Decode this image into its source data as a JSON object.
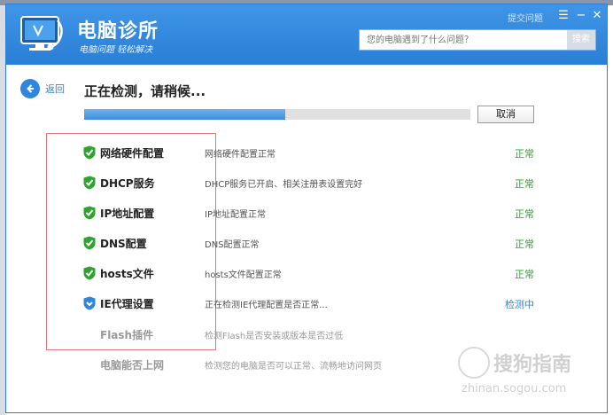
{
  "window": {
    "app_title": "电脑诊所",
    "app_subtitle": "电脑问题 轻松解决",
    "feedback": "提交问题"
  },
  "search": {
    "placeholder": "您的电脑遇到了什么问题？",
    "button_label": "搜索"
  },
  "nav": {
    "back_label": "返回"
  },
  "scan": {
    "status_title": "正在检测，请稍候...",
    "progress": 0.52,
    "cancel_label": "取消"
  },
  "checks": [
    {
      "name": "网络硬件配置",
      "desc": "网络硬件配置正常",
      "state": "正常",
      "status": "ok"
    },
    {
      "name": "DHCP服务",
      "desc": "DHCP服务已开启、相关注册表设置完好",
      "state": "正常",
      "status": "ok"
    },
    {
      "name": "IP地址配置",
      "desc": "IP地址配置正常",
      "state": "正常",
      "status": "ok"
    },
    {
      "name": "DNS配置",
      "desc": "DNS配置正常",
      "state": "正常",
      "status": "ok"
    },
    {
      "name": "hosts文件",
      "desc": "hosts文件配置正常",
      "state": "正常",
      "status": "ok"
    },
    {
      "name": "IE代理设置",
      "desc": "正在检测IE代理配置是否正常...",
      "state": "检测中",
      "status": "checking"
    },
    {
      "name": "Flash插件",
      "desc": "检测Flash是否安装或版本是否过低",
      "state": "",
      "status": "pending"
    },
    {
      "name": "电脑能否上网",
      "desc": "检测您的电脑是否可以正常、流畅地访问网页",
      "state": "",
      "status": "pending"
    }
  ],
  "watermark": {
    "brand": "搜狗指南",
    "url": "zhinan.sogou.com"
  },
  "colors": {
    "title_bar": "#3a8ce2",
    "ok": "#2ea32e",
    "checking": "#2f86dc",
    "accent": "#2f86dc"
  },
  "icons": {
    "ok": "green-shield-check-icon",
    "checking": "blue-shield-icon",
    "back": "left-arrow-icon",
    "logo": "monitor-stethoscope-icon"
  }
}
